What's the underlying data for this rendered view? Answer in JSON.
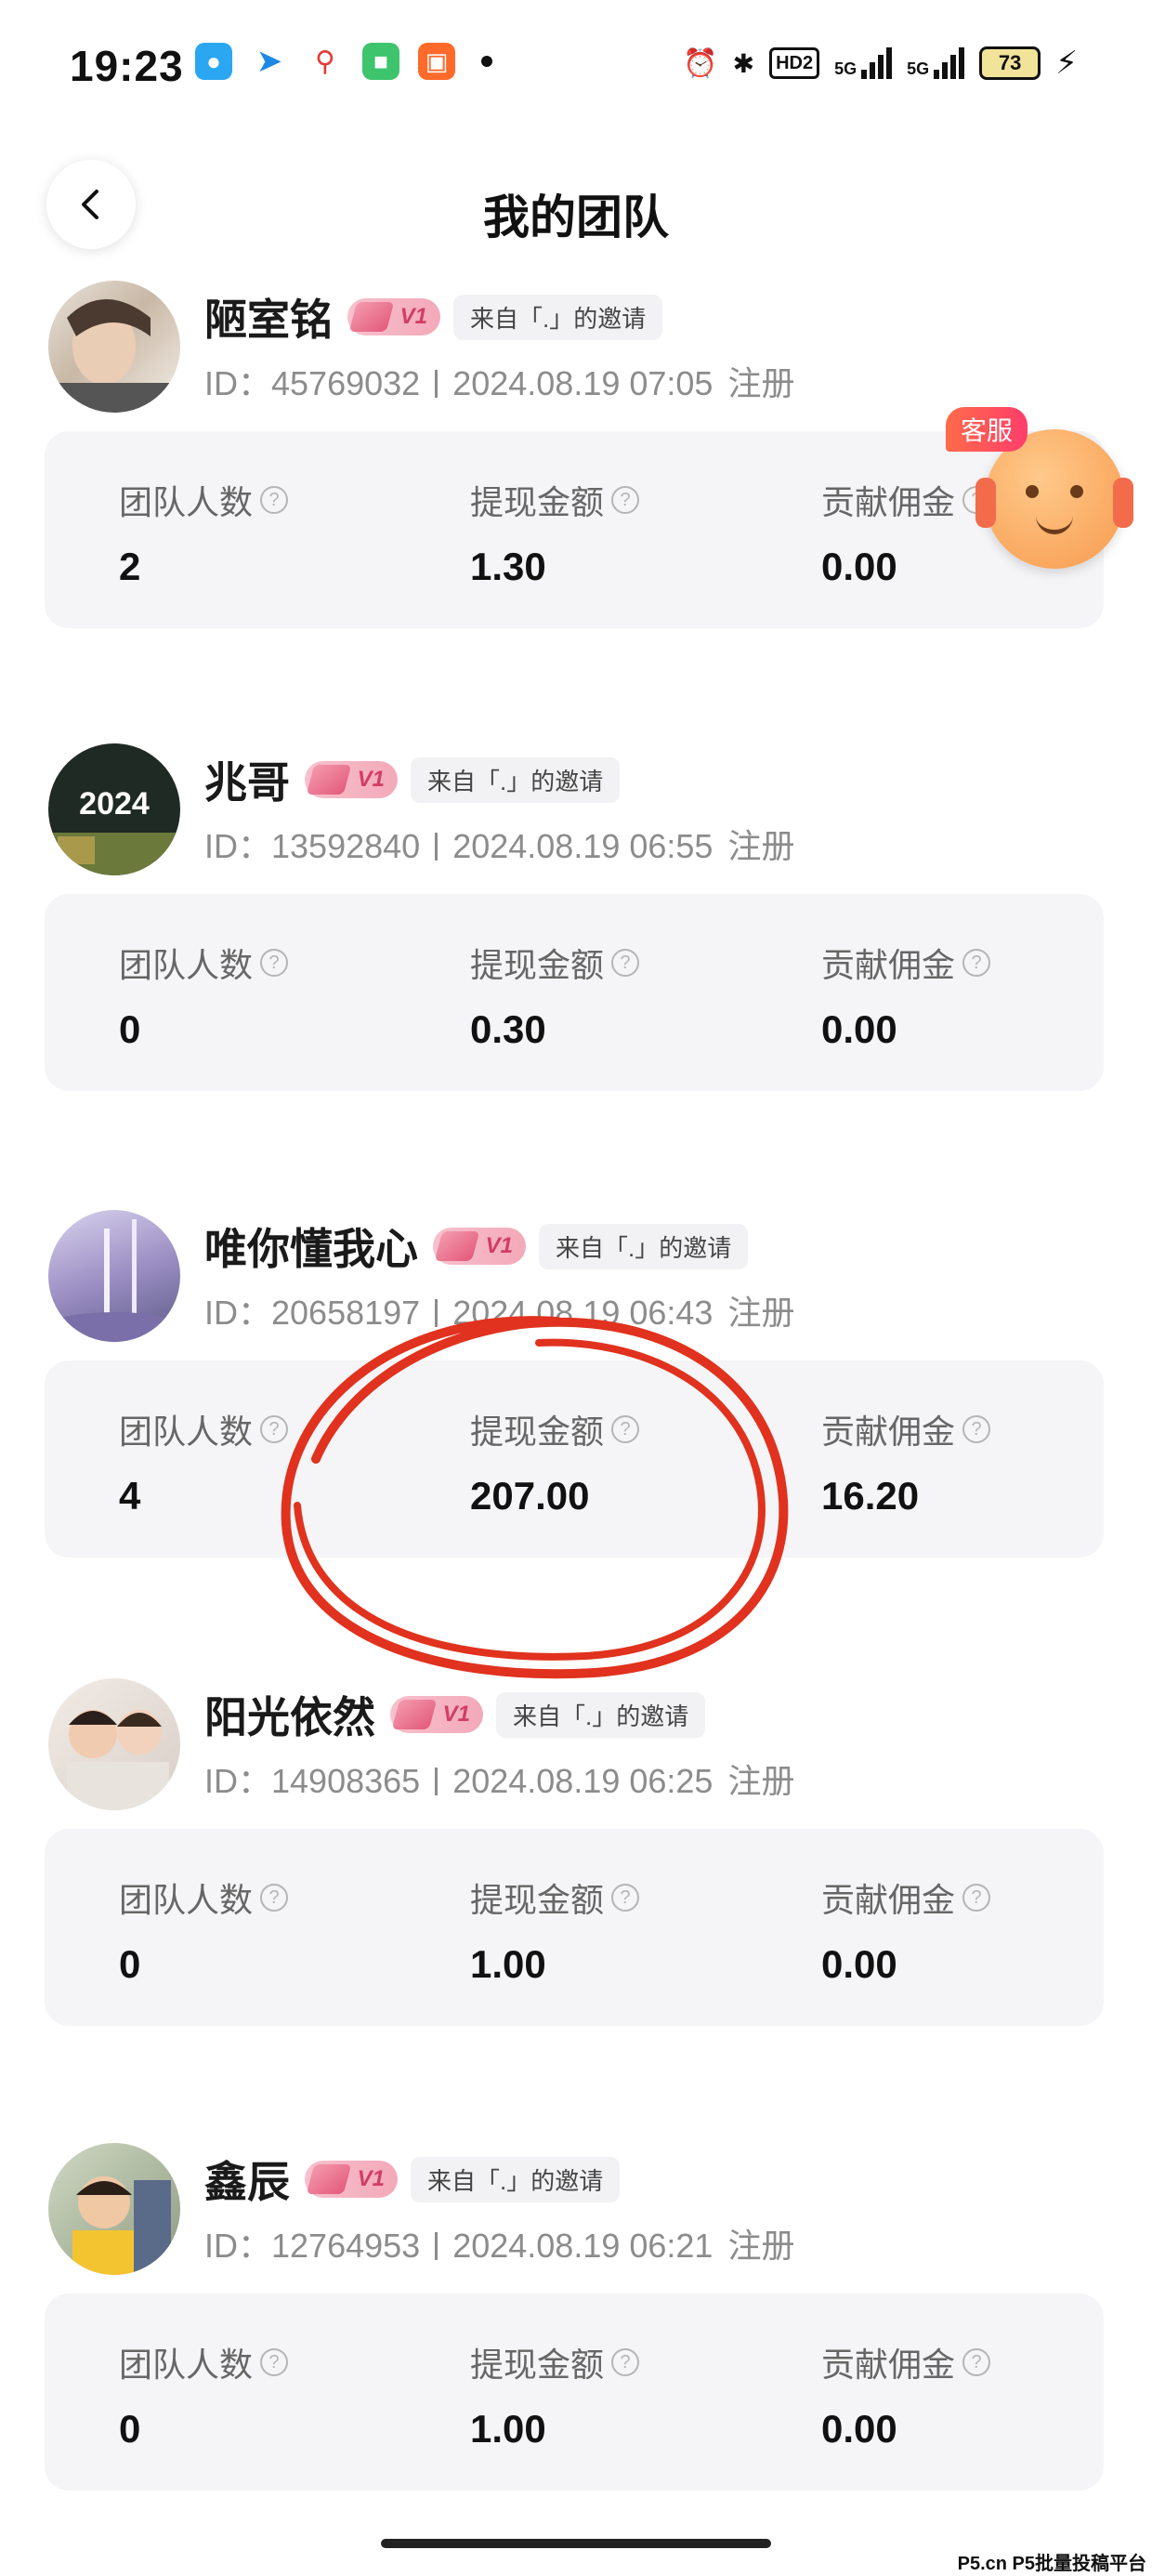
{
  "status_bar": {
    "time": "19:23",
    "net1": "5G",
    "net2": "5G",
    "hd": "HD2",
    "battery": "73",
    "icons": [
      "qq-icon",
      "arrow-app-icon",
      "map-pin-icon",
      "wechat-icon",
      "shop-icon"
    ]
  },
  "header": {
    "title": "我的团队"
  },
  "labels": {
    "team_count": "团队人数",
    "withdraw_amount": "提现金额",
    "contrib_commission": "贡献佣金",
    "id_prefix": "ID：",
    "register": "注册",
    "invite": "来自「.」的邀请",
    "level": "V1"
  },
  "service": {
    "label": "客服"
  },
  "members": [
    {
      "name": "陋室铭",
      "id": "45769032",
      "date": "2024.08.19 07:05",
      "team_count": "2",
      "withdraw": "1.30",
      "commission": "0.00"
    },
    {
      "name": "兆哥",
      "id": "13592840",
      "date": "2024.08.19 06:55",
      "team_count": "0",
      "withdraw": "0.30",
      "commission": "0.00"
    },
    {
      "name": "唯你懂我心",
      "id": "20658197",
      "date": "2024.08.19 06:43",
      "team_count": "4",
      "withdraw": "207.00",
      "commission": "16.20"
    },
    {
      "name": "阳光依然",
      "id": "14908365",
      "date": "2024.08.19 06:25",
      "team_count": "0",
      "withdraw": "1.00",
      "commission": "0.00"
    },
    {
      "name": "鑫辰",
      "id": "12764953",
      "date": "2024.08.19 06:21",
      "team_count": "0",
      "withdraw": "1.00",
      "commission": "0.00"
    }
  ],
  "avatar_texts": {
    "m2": "2024"
  },
  "watermark": "P5.cn P5批量投稿平台",
  "colors": {
    "accent_red": "#e0321e",
    "badge_pink": "#f3a9b9",
    "card_bg": "#f5f5f7"
  }
}
